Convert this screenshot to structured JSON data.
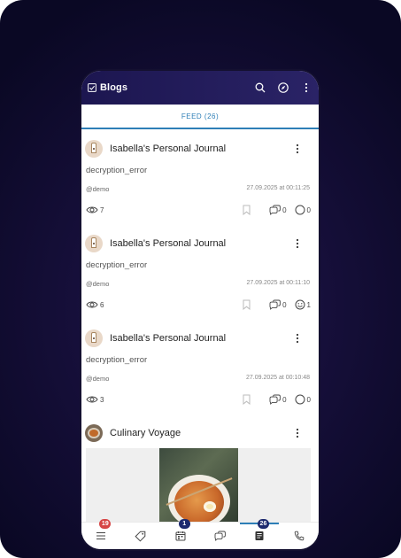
{
  "app": {
    "title": "Blogs"
  },
  "toolbar": {
    "icons": [
      "search-icon",
      "compass-icon",
      "more-vertical-icon"
    ]
  },
  "tabs": {
    "feed_label": "FEED (26)"
  },
  "posts": [
    {
      "blog_name": "Isabella's Personal Journal",
      "content": "decryption_error",
      "author": "@demo",
      "date": "27.09.2025 at 00:11:25",
      "views": "7",
      "comments": "0",
      "reactions": "0"
    },
    {
      "blog_name": "Isabella's Personal Journal",
      "content": "decryption_error",
      "author": "@demo",
      "date": "27.09.2025 at 00:11:10",
      "views": "6",
      "comments": "0",
      "reactions": "1"
    },
    {
      "blog_name": "Isabella's Personal Journal",
      "content": "decryption_error",
      "author": "@demo",
      "date": "27.09.2025 at 00:10:48",
      "views": "3",
      "comments": "0",
      "reactions": "0"
    },
    {
      "blog_name": "Culinary Voyage"
    }
  ],
  "bottom_nav": {
    "items": [
      {
        "icon": "menu-icon",
        "badge": "19"
      },
      {
        "icon": "tag-icon"
      },
      {
        "icon": "calendar-icon",
        "badge": "1"
      },
      {
        "icon": "chat-icon"
      },
      {
        "icon": "blogs-icon",
        "badge": "26",
        "active": true
      },
      {
        "icon": "phone-icon"
      }
    ]
  },
  "colors": {
    "header": "#1c1650",
    "accent": "#2e7fb7",
    "badge_red": "#d64545",
    "badge_navy": "#1d2a6e"
  }
}
